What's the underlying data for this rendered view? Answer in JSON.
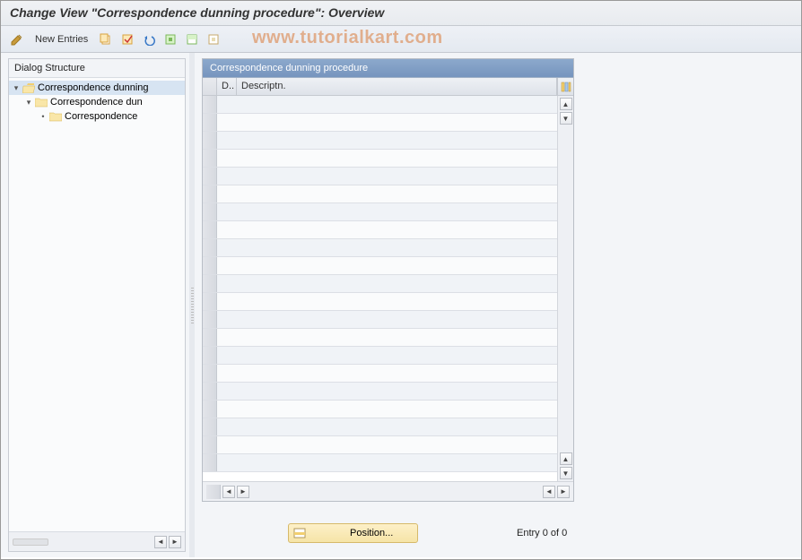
{
  "title": "Change View \"Correspondence dunning procedure\": Overview",
  "watermark": "www.tutorialkart.com",
  "toolbar": {
    "new_entries_label": "New Entries"
  },
  "sidebar": {
    "title": "Dialog Structure",
    "items": [
      {
        "label": "Correspondence dunning",
        "level": 0,
        "open": true,
        "selected": true
      },
      {
        "label": "Correspondence dun",
        "level": 1,
        "open": true,
        "selected": false
      },
      {
        "label": "Correspondence",
        "level": 2,
        "open": false,
        "selected": false
      }
    ]
  },
  "grid": {
    "title": "Correspondence dunning procedure",
    "columns": {
      "d": "D..",
      "desc": "Descriptn."
    }
  },
  "footer": {
    "position_label": "Position...",
    "entry_text": "Entry 0 of 0"
  }
}
